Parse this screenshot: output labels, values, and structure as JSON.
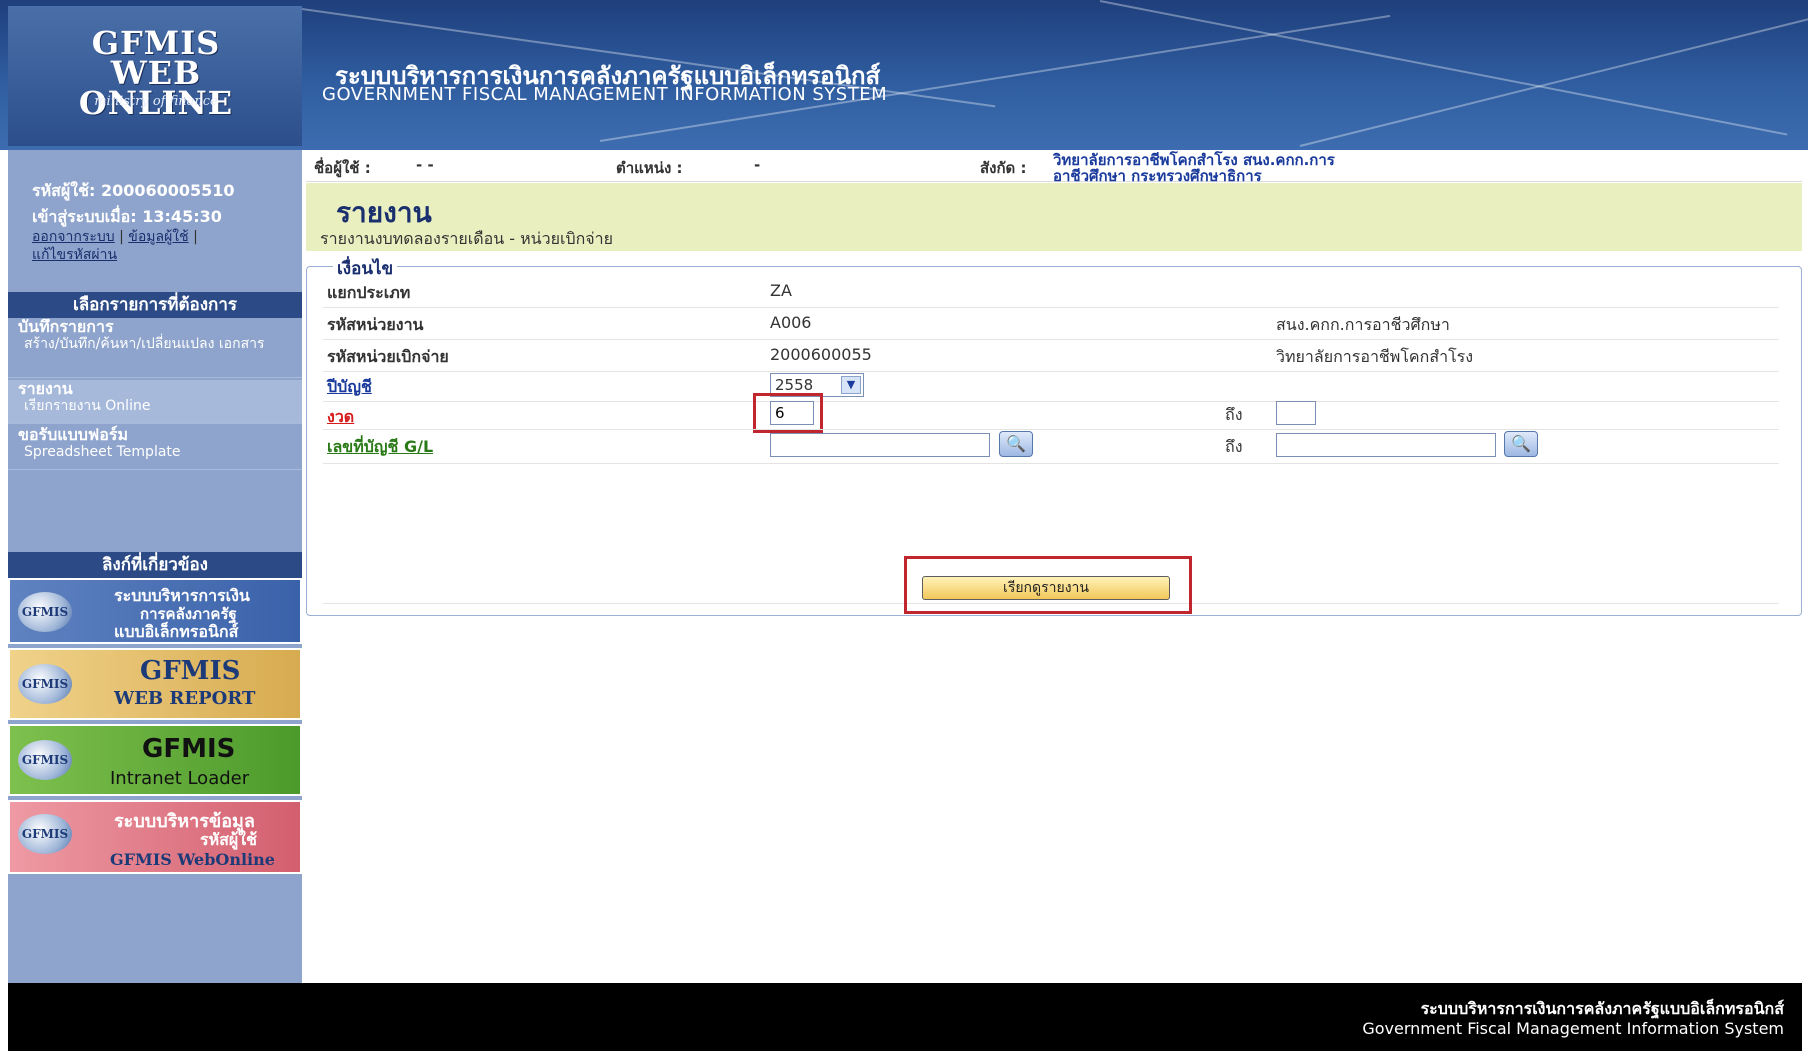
{
  "header": {
    "logo_line1": "GFMIS",
    "logo_line2": "WEB ONLINE",
    "logo_sub": "ministry of finance",
    "system_th": "ระบบบริหารการเงินการคลังภาครัฐแบบอิเล็กทรอนิกส์",
    "system_en": "GOVERNMENT FISCAL MANAGEMENT INFORMATION SYSTEM"
  },
  "user": {
    "id_label": "รหัสผู้ใช้:",
    "id_value": "200060005510",
    "login_label": "เข้าสู่ระบบเมื่อ:",
    "login_value": "13:45:30",
    "link_logout": "ออกจากระบบ",
    "link_userinfo": "ข้อมูลผู้ใช้",
    "link_changepw": "แก้ไขรหัสผ่าน",
    "sep": "|"
  },
  "sidebar": {
    "menu_header": "เลือกรายการที่ต้องการ",
    "sections": [
      {
        "title": "บันทึกรายการ",
        "sub": "สร้าง/บันทึก/ค้นหา/เปลี่ยนแปลง เอกสาร"
      },
      {
        "title": "รายงาน",
        "sub": "เรียกรายงาน Online"
      },
      {
        "title": "ขอรับแบบฟอร์ม",
        "sub": "Spreadsheet Template"
      }
    ],
    "related_header": "ลิงก์ที่เกี่ยวข้อง",
    "banners": [
      {
        "logo": "GFMIS",
        "t1": "ระบบบริหารการเงิน",
        "t2": "การคลังภาครัฐ",
        "t3": "แบบอิเล็กทรอนิกส์"
      },
      {
        "logo": "GFMIS",
        "t1": "GFMIS",
        "t2": "WEB REPORT"
      },
      {
        "logo": "GFMIS",
        "t1": "GFMIS",
        "t2": "Intranet Loader"
      },
      {
        "logo": "GFMIS",
        "t1": "ระบบบริหารข้อมูล",
        "t2": "รหัสผู้ใช้",
        "t3": "GFMIS WebOnline"
      }
    ]
  },
  "info_bar": {
    "user_label": "ชื่อผู้ใช้ :",
    "user_value": "- -",
    "position_label": "ตำแหน่ง :",
    "position_value": "-",
    "org_label": "สังกัด :",
    "org_value_line1": "วิทยาลัยการอาชีพโคกสำโรง สนง.คกก.การ",
    "org_value_line2": "อาชีวศึกษา กระทรวงศึกษาธิการ"
  },
  "page": {
    "title": "รายงาน",
    "subtitle": "รายงานงบทดลองรายเดือน - หน่วยเบิกจ่าย",
    "conditions_legend": "เงื่อนไข"
  },
  "form": {
    "category_label": "แยกประเภท",
    "category_value": "ZA",
    "agency_label": "รหัสหน่วยงาน",
    "agency_value": "A006",
    "agency_name": "สนง.คกก.การอาชีวศึกษา",
    "disb_label": "รหัสหน่วยเบิกจ่าย",
    "disb_value": "2000600055",
    "disb_name": "วิทยาลัยการอาชีพโคกสำโรง",
    "fiscal_label": "ปีบัญชี",
    "fiscal_value": "2558",
    "period_label": "งวด",
    "period_from": "6",
    "period_to_label": "ถึง",
    "period_to": "",
    "gl_label": "เลขที่บัญชี G/L",
    "gl_from": "",
    "gl_to_label": "ถึง",
    "gl_to": "",
    "run_button": "เรียกดูรายงาน"
  },
  "footer": {
    "th": "ระบบบริหารการเงินการคลังภาครัฐแบบอิเล็กทรอนิกส์",
    "en": "Government Fiscal Management Information System"
  },
  "colors": {
    "header_bg": "#2f5da0",
    "sidebar_bg": "#8ea4cc",
    "title_band": "#e9efbf",
    "highlight": "#c0262d"
  }
}
